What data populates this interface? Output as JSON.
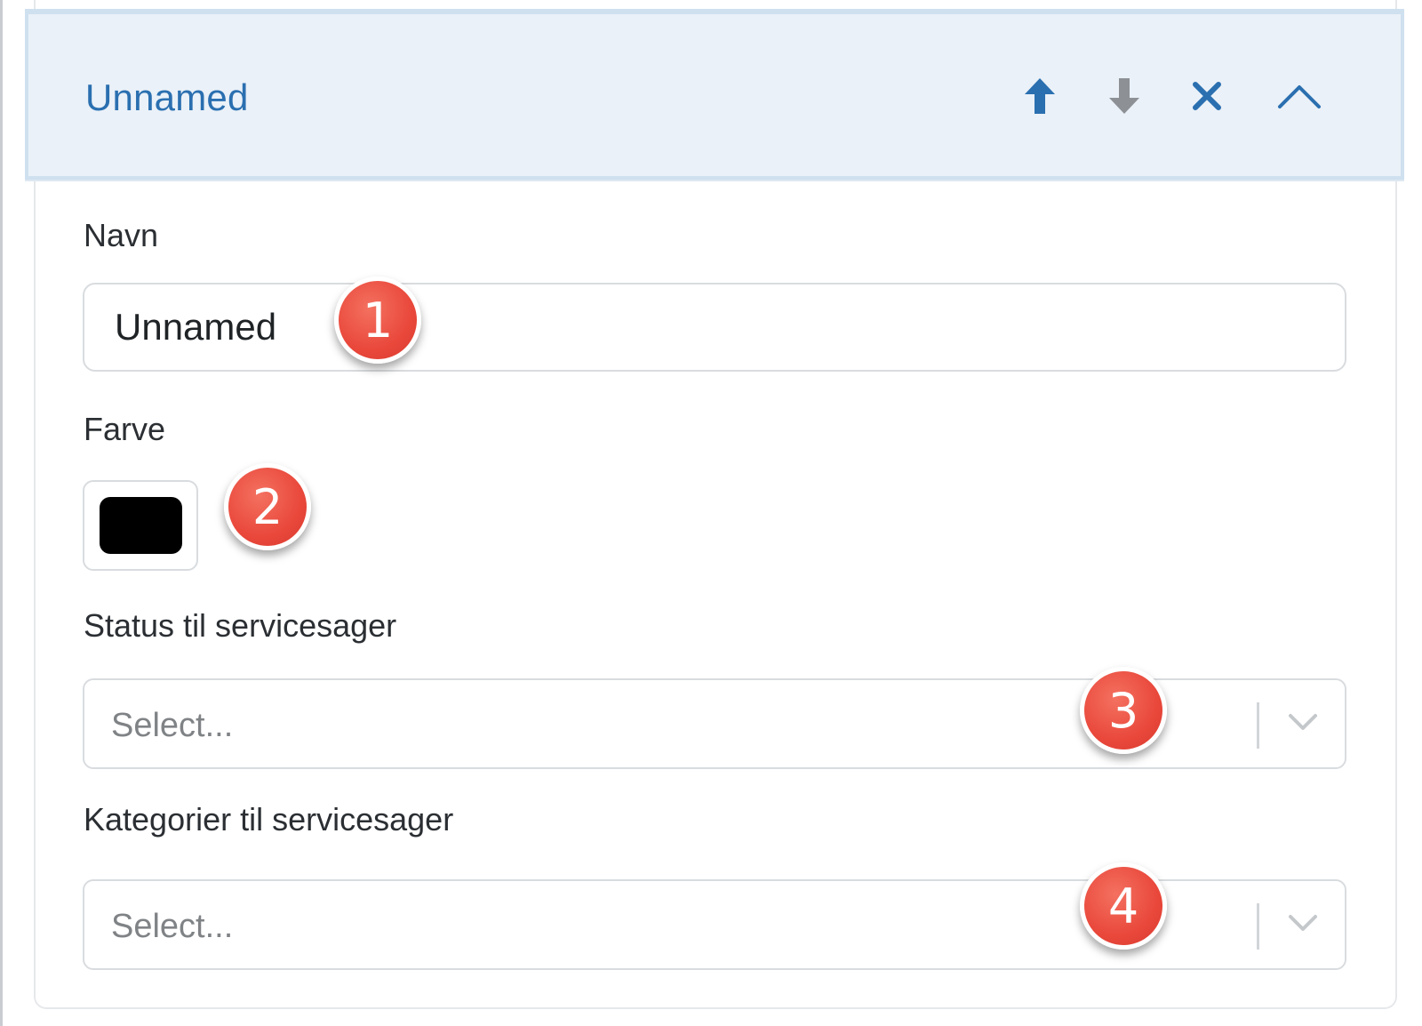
{
  "header": {
    "title": "Unnamed",
    "actions": {
      "move_up": {
        "icon": "arrow-up-icon"
      },
      "move_down": {
        "icon": "arrow-down-icon"
      },
      "remove": {
        "icon": "close-icon"
      },
      "collapse": {
        "icon": "chevron-up-icon"
      }
    }
  },
  "form": {
    "name": {
      "label": "Navn",
      "value": "Unnamed"
    },
    "color": {
      "label": "Farve",
      "value": "#000000"
    },
    "status": {
      "label": "Status til servicesager",
      "placeholder": "Select..."
    },
    "categories": {
      "label": "Kategorier til servicesager",
      "placeholder": "Select..."
    }
  },
  "annotations": [
    "1",
    "2",
    "3",
    "4"
  ],
  "colors": {
    "accent": "#2a6fb0",
    "header_bg": "#eaf1f8",
    "badge": "#e9483b"
  }
}
